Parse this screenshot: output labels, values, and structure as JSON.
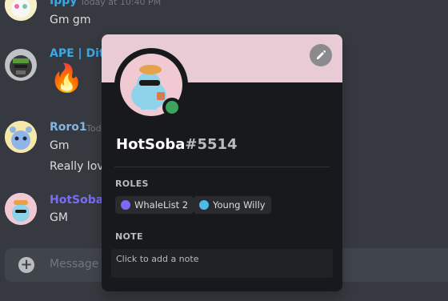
{
  "messages": [
    {
      "author": "Ippy",
      "timestamp": "Today at 10:40 PM",
      "lines": [
        "Gm gm"
      ],
      "author_color": "#3ba9e6"
    },
    {
      "author": "APE | Dits",
      "timestamp": "",
      "lines": [
        "🔥"
      ],
      "author_color": "#3ba9e6"
    },
    {
      "author": "Roro1",
      "timestamp": "Tod",
      "lines": [
        "Gm",
        "Really love"
      ],
      "author_color": "#7fb6e6"
    },
    {
      "author": "HotSoba",
      "timestamp": "",
      "lines": [
        "GM"
      ],
      "author_color": "#7b6cf6"
    }
  ],
  "composer": {
    "placeholder": "Message"
  },
  "profile": {
    "username": "HotSoba",
    "discriminator": "#5514",
    "banner_color": "#e8cbd5",
    "status": "online",
    "roles_label": "ROLES",
    "roles": [
      {
        "name": "WhaleList 2",
        "color": "#7a6af5"
      },
      {
        "name": "Young Willy",
        "color": "#4fb9ec"
      }
    ],
    "note_label": "NOTE",
    "note_placeholder": "Click to add a note"
  },
  "icons": {
    "edit": "pencil-icon",
    "add": "plus-icon",
    "status": "online-status-icon"
  }
}
